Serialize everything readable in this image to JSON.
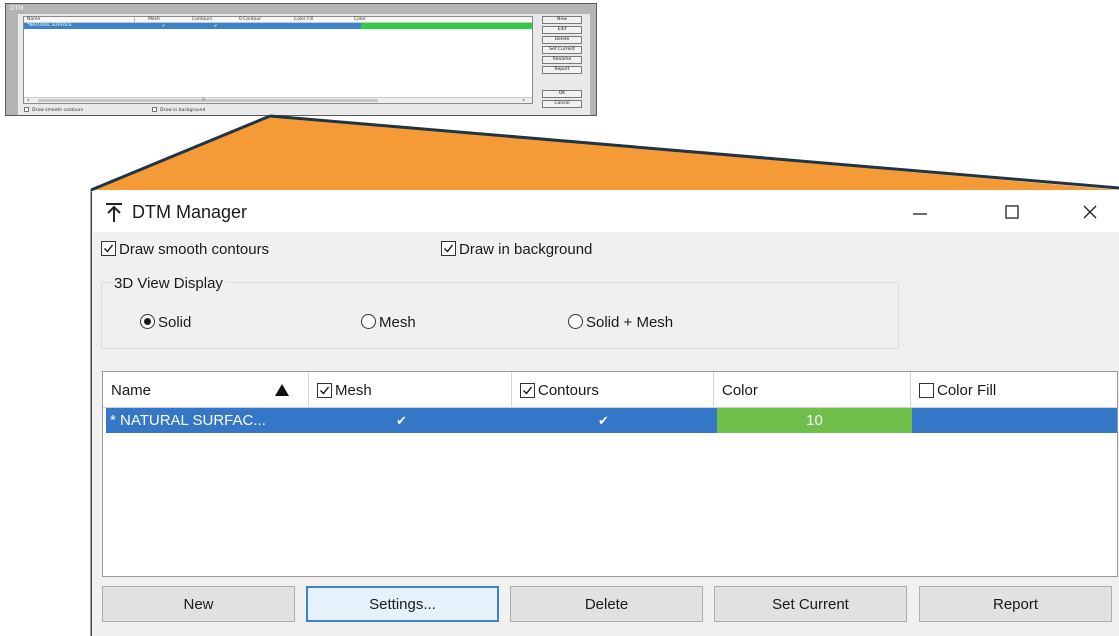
{
  "old_dialog": {
    "title": "DTM",
    "columns": [
      "Name",
      "Mesh",
      "Contours",
      "0 Contour",
      "Color Fill",
      "Color"
    ],
    "row": {
      "name": "*NATURAL SURFACE"
    },
    "checkboxes": [
      "Draw smooth contours",
      "Draw in background"
    ],
    "scroll_marker": "III",
    "buttons": [
      "New",
      "Edit",
      "Delete",
      "Set Current",
      "Rename",
      "Report",
      "OK",
      "Cancel"
    ]
  },
  "window": {
    "title": "DTM Manager",
    "minimize_glyph": "—",
    "maximize_glyph": "☐",
    "close_glyph": "✕"
  },
  "options": {
    "smooth_contours": {
      "label": "Draw smooth contours",
      "checked": true
    },
    "draw_background": {
      "label": "Draw in background",
      "checked": true
    }
  },
  "view_display": {
    "label": "3D View Display",
    "options": [
      {
        "label": "Solid",
        "selected": true
      },
      {
        "label": "Mesh",
        "selected": false
      },
      {
        "label": "Solid + Mesh",
        "selected": false
      }
    ]
  },
  "grid": {
    "columns": [
      {
        "label": "Name",
        "sorted": "asc"
      },
      {
        "label": "Mesh",
        "checked": true
      },
      {
        "label": "Contours",
        "checked": true
      },
      {
        "label": "Color"
      },
      {
        "label": "Color Fill",
        "checked": false
      }
    ],
    "rows": [
      {
        "name": "* NATURAL SURFAC...",
        "mesh": "✔",
        "contours": "✔",
        "color": "10",
        "color_hex": "#6fc04b",
        "selected": true
      }
    ]
  },
  "buttons": {
    "new": "New",
    "settings": "Settings...",
    "delete": "Delete",
    "set_current": "Set Current",
    "report": "Report"
  },
  "colors": {
    "callout": "#f49a36",
    "selection": "#3477c6",
    "swatch": "#6fc04b"
  }
}
